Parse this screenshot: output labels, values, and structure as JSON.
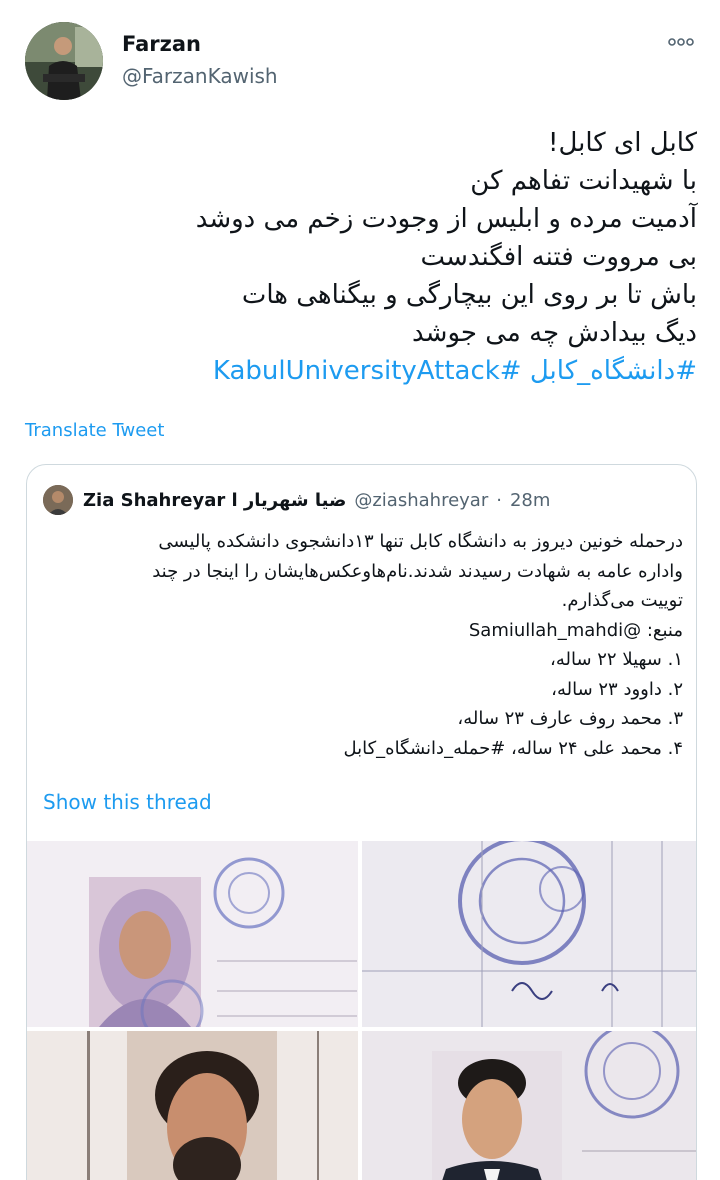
{
  "tweet": {
    "author_name": "Farzan",
    "author_handle": "@FarzanKawish",
    "more_icon": "more-horizontal-icon",
    "lines": [
      "کابل ای کابل!",
      "با شهیدانت تفاهم کن",
      "آدمیت مرده و ابلیس از وجودت زخم می دوشد",
      "بی مرووت فتنه افگندست",
      "باش تا بر روی این بیچارگی و بیگناهی هات",
      "دیگ بیدادش چه می جوشد"
    ],
    "hashtag_line": "#دانشگاه_کابل #KabulUniversityAttack",
    "translate_label": "Translate Tweet"
  },
  "quote": {
    "author_name": "Zia Shahreyar l ضیا شهریار",
    "author_handle": "@ziashahreyar",
    "separator": "·",
    "time": "28m",
    "lines": [
      "درحمله خونین دیروز به دانشگاه کابل تنها ۱۳دانشجوی دانشکده پالیسی",
      "واداره عامه به شهادت رسیدند شدند.نام‌هاوعکس‌هایشان را اینجا در چند",
      "توییت می‌گذارم.",
      "منبع: @Samiullah_mahdi",
      "۱. سهیلا ۲۲ ساله،",
      "۲. داوود ۲۳ ساله،",
      "۳. محمد روف عارف ۲۳ ساله،",
      "۴. محمد علی ۲۴ ساله، #حمله_دانشگاه_کابل"
    ],
    "show_thread_label": "Show this thread"
  },
  "colors": {
    "link": "#1d9bf0",
    "text": "#0f1419",
    "muted": "#536471",
    "border": "#cfd9de",
    "stamp": "#5a5fb0"
  }
}
